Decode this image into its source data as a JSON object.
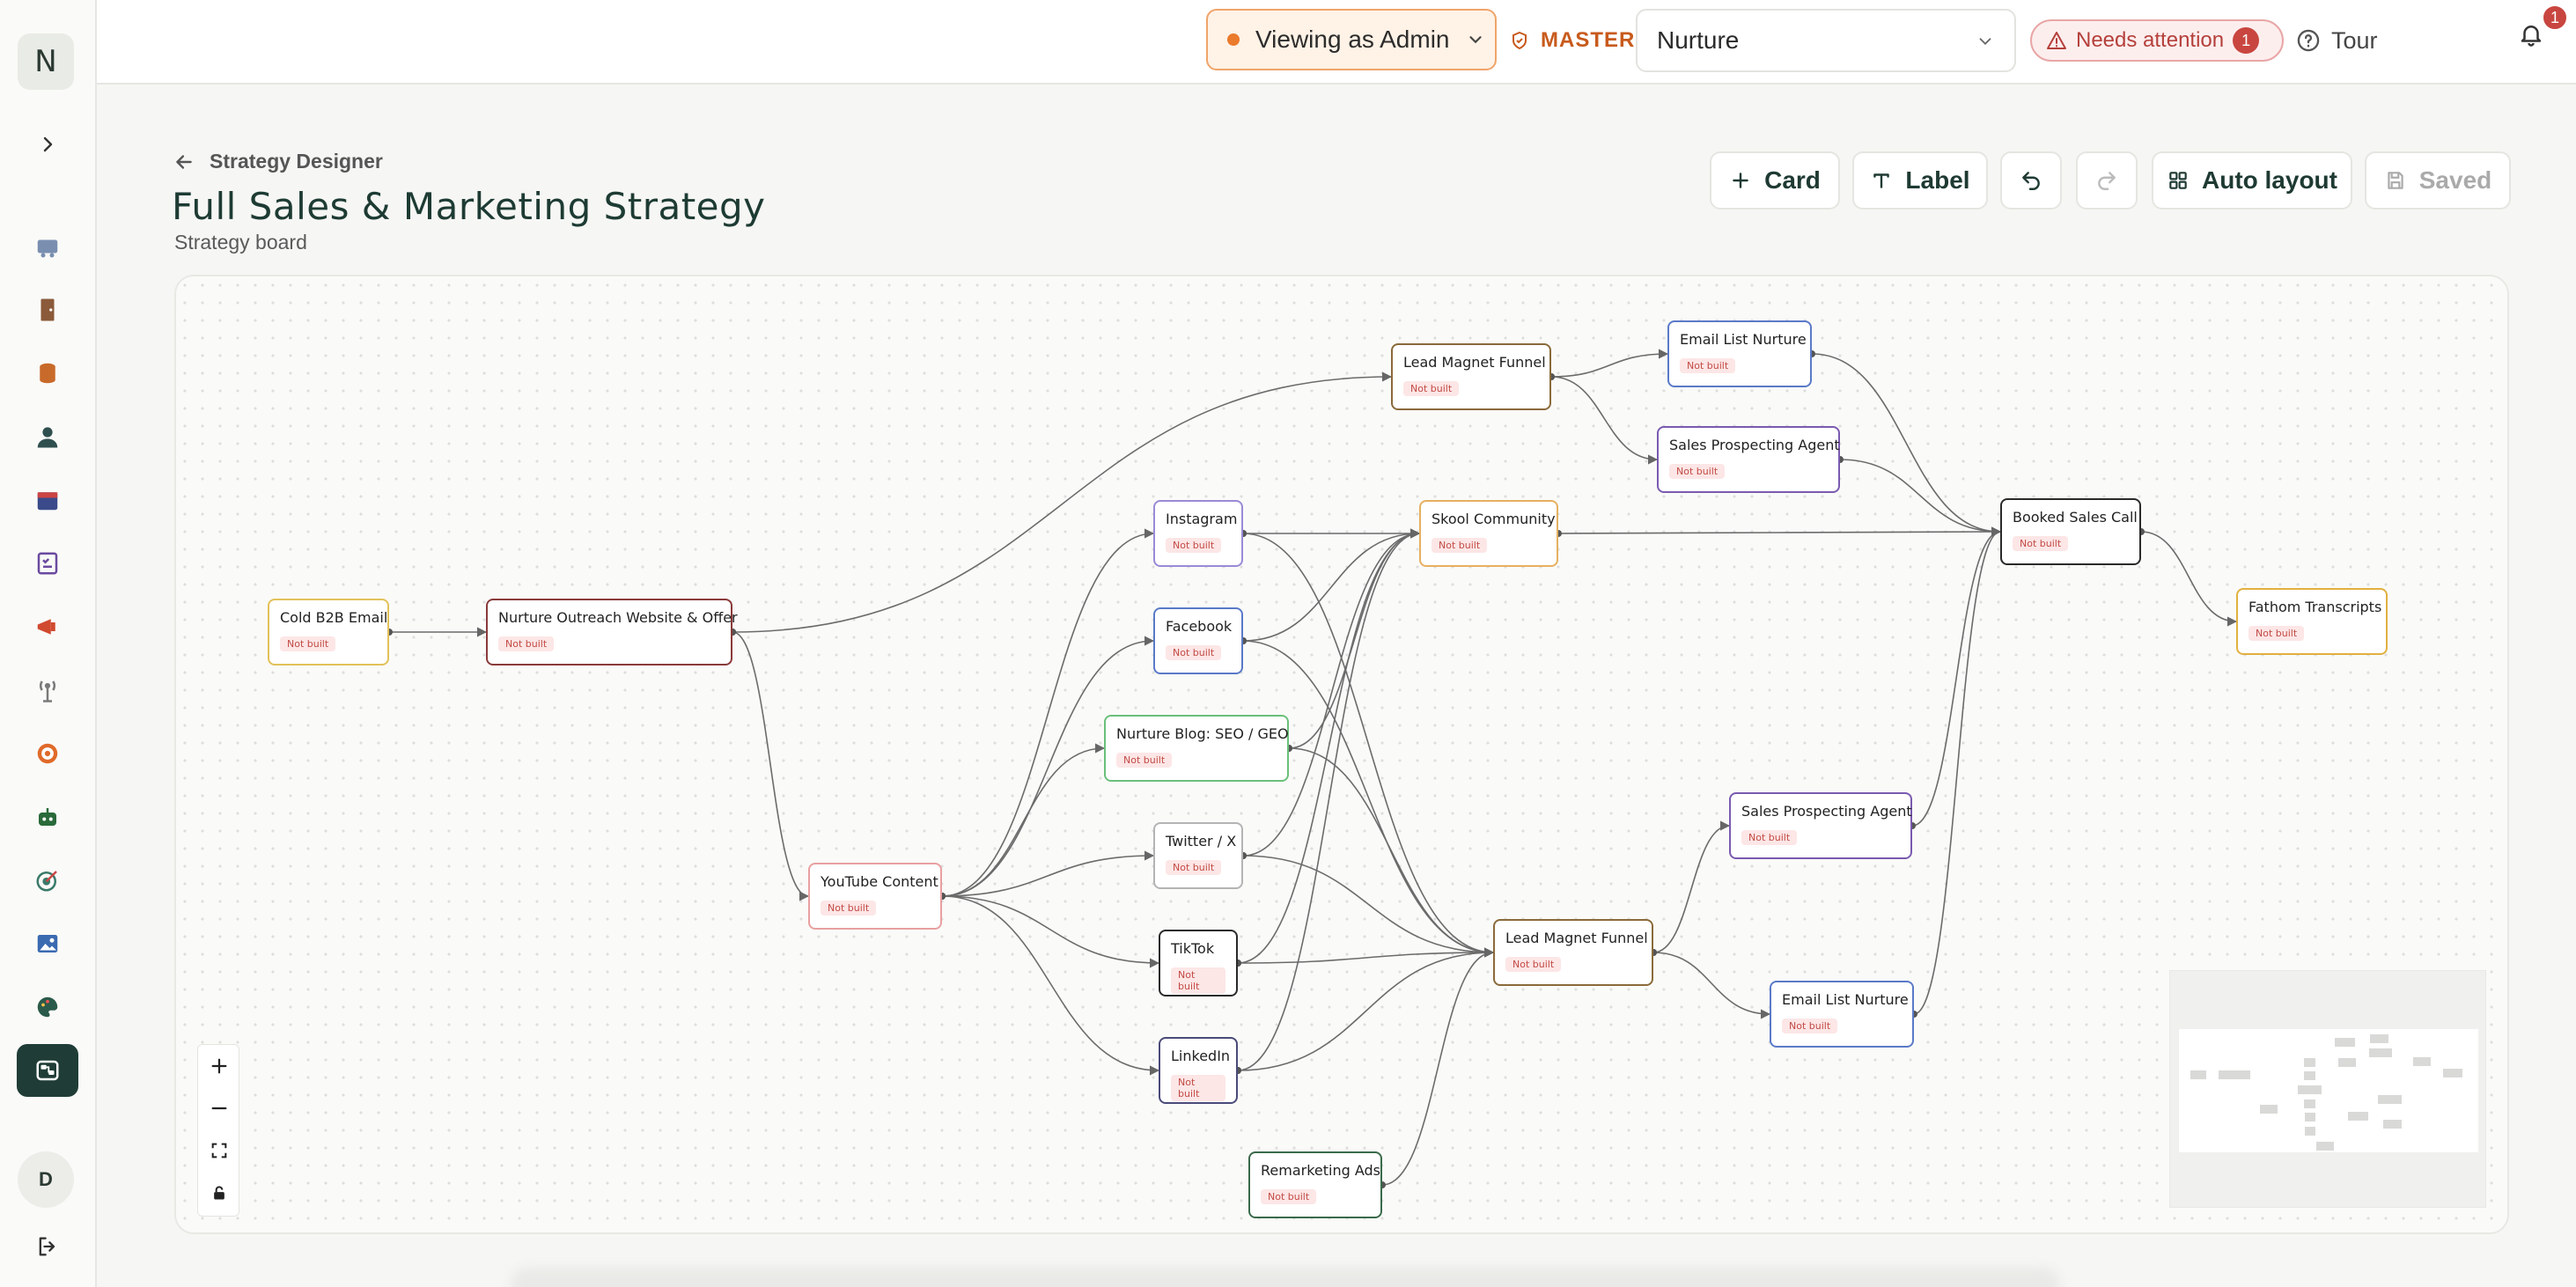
{
  "sidebar": {
    "logo_letter": "N",
    "avatar_letter": "D",
    "items": [
      {
        "icon": "cart-icon",
        "color": "#7a8fb0"
      },
      {
        "icon": "door-icon",
        "color": "#8b5a3a"
      },
      {
        "icon": "database-icon",
        "color": "#c86a2a"
      },
      {
        "icon": "person-icon",
        "color": "#2f4f4f"
      },
      {
        "icon": "calendar-icon",
        "color": "#3a4a8a"
      },
      {
        "icon": "checklist-icon",
        "color": "#6a4aa0"
      },
      {
        "icon": "megaphone-icon",
        "color": "#d04a30"
      },
      {
        "icon": "antenna-icon",
        "color": "#7a7a7a"
      },
      {
        "icon": "target-icon",
        "color": "#e06a2a"
      },
      {
        "icon": "robot-icon",
        "color": "#2a6a3a"
      },
      {
        "icon": "dart-icon",
        "color": "#3a7a6a"
      },
      {
        "icon": "image-icon",
        "color": "#3a6ab0"
      },
      {
        "icon": "palette-icon",
        "color": "#2a5a4a"
      },
      {
        "icon": "strategy-board-icon",
        "color": "#ffffff",
        "active": true
      }
    ]
  },
  "topbar": {
    "viewing_label": "Viewing as Admin",
    "master_label": "MASTER",
    "workspace_value": "Nurture",
    "needs_attention_label": "Needs attention",
    "needs_attention_count": "1",
    "tour_label": "Tour",
    "notification_count": "1"
  },
  "header": {
    "breadcrumb": "Strategy Designer",
    "title": "Full Sales & Marketing Strategy",
    "subtitle": "Strategy board"
  },
  "toolbar": {
    "card_label": "Card",
    "label_label": "Label",
    "auto_layout_label": "Auto layout",
    "saved_label": "Saved"
  },
  "board": {
    "status_label": "Not built",
    "nodes": [
      {
        "id": "cold",
        "title": "Cold B2B Email",
        "color": "#e2c15a"
      },
      {
        "id": "nowo",
        "title": "Nurture Outreach Website & Offer",
        "color": "#8a3a3a"
      },
      {
        "id": "yt",
        "title": "YouTube Content",
        "color": "#e8a0a0"
      },
      {
        "id": "ig",
        "title": "Instagram",
        "color": "#9a8ad6"
      },
      {
        "id": "fb",
        "title": "Facebook",
        "color": "#5a7ac8"
      },
      {
        "id": "blog",
        "title": "Nurture Blog: SEO / GEO",
        "color": "#6ac07a"
      },
      {
        "id": "tw",
        "title": "Twitter / X",
        "color": "#b4b4b4"
      },
      {
        "id": "tt",
        "title": "TikTok",
        "color": "#2a2a2a"
      },
      {
        "id": "li",
        "title": "LinkedIn",
        "color": "#4a4a7a"
      },
      {
        "id": "ads",
        "title": "Remarketing Ads",
        "color": "#3a6a4a"
      },
      {
        "id": "lmf1",
        "title": "Lead Magnet Funnel",
        "color": "#8a6a3a"
      },
      {
        "id": "skool",
        "title": "Skool Community",
        "color": "#e6b060"
      },
      {
        "id": "lmf2",
        "title": "Lead Magnet Funnel",
        "color": "#8a6a3a"
      },
      {
        "id": "eln1",
        "title": "Email List Nurture",
        "color": "#5a7ac8"
      },
      {
        "id": "spa1",
        "title": "Sales Prospecting Agent",
        "color": "#7a5ab0"
      },
      {
        "id": "spa2",
        "title": "Sales Prospecting Agent",
        "color": "#7a5ab0"
      },
      {
        "id": "eln2",
        "title": "Email List Nurture",
        "color": "#5a7ac8"
      },
      {
        "id": "bsc",
        "title": "Booked Sales Call",
        "color": "#2a2a2a"
      },
      {
        "id": "fathom",
        "title": "Fathom Transcripts",
        "color": "#e2b040"
      }
    ],
    "edges": [
      [
        "cold",
        "nowo"
      ],
      [
        "nowo",
        "lmf1"
      ],
      [
        "nowo",
        "yt"
      ],
      [
        "yt",
        "ig"
      ],
      [
        "yt",
        "fb"
      ],
      [
        "yt",
        "blog"
      ],
      [
        "yt",
        "tw"
      ],
      [
        "yt",
        "tt"
      ],
      [
        "yt",
        "li"
      ],
      [
        "ig",
        "skool"
      ],
      [
        "fb",
        "skool"
      ],
      [
        "blog",
        "skool"
      ],
      [
        "tw",
        "skool"
      ],
      [
        "tt",
        "skool"
      ],
      [
        "li",
        "skool"
      ],
      [
        "ig",
        "lmf2"
      ],
      [
        "fb",
        "lmf2"
      ],
      [
        "blog",
        "lmf2"
      ],
      [
        "tw",
        "lmf2"
      ],
      [
        "tt",
        "lmf2"
      ],
      [
        "li",
        "lmf2"
      ],
      [
        "ads",
        "lmf2"
      ],
      [
        "lmf1",
        "eln1"
      ],
      [
        "lmf1",
        "spa1"
      ],
      [
        "skool",
        "bsc"
      ],
      [
        "eln1",
        "bsc"
      ],
      [
        "spa1",
        "bsc"
      ],
      [
        "lmf2",
        "spa2"
      ],
      [
        "lmf2",
        "eln2"
      ],
      [
        "spa2",
        "bsc"
      ],
      [
        "eln2",
        "bsc"
      ],
      [
        "bsc",
        "fathom"
      ]
    ]
  }
}
